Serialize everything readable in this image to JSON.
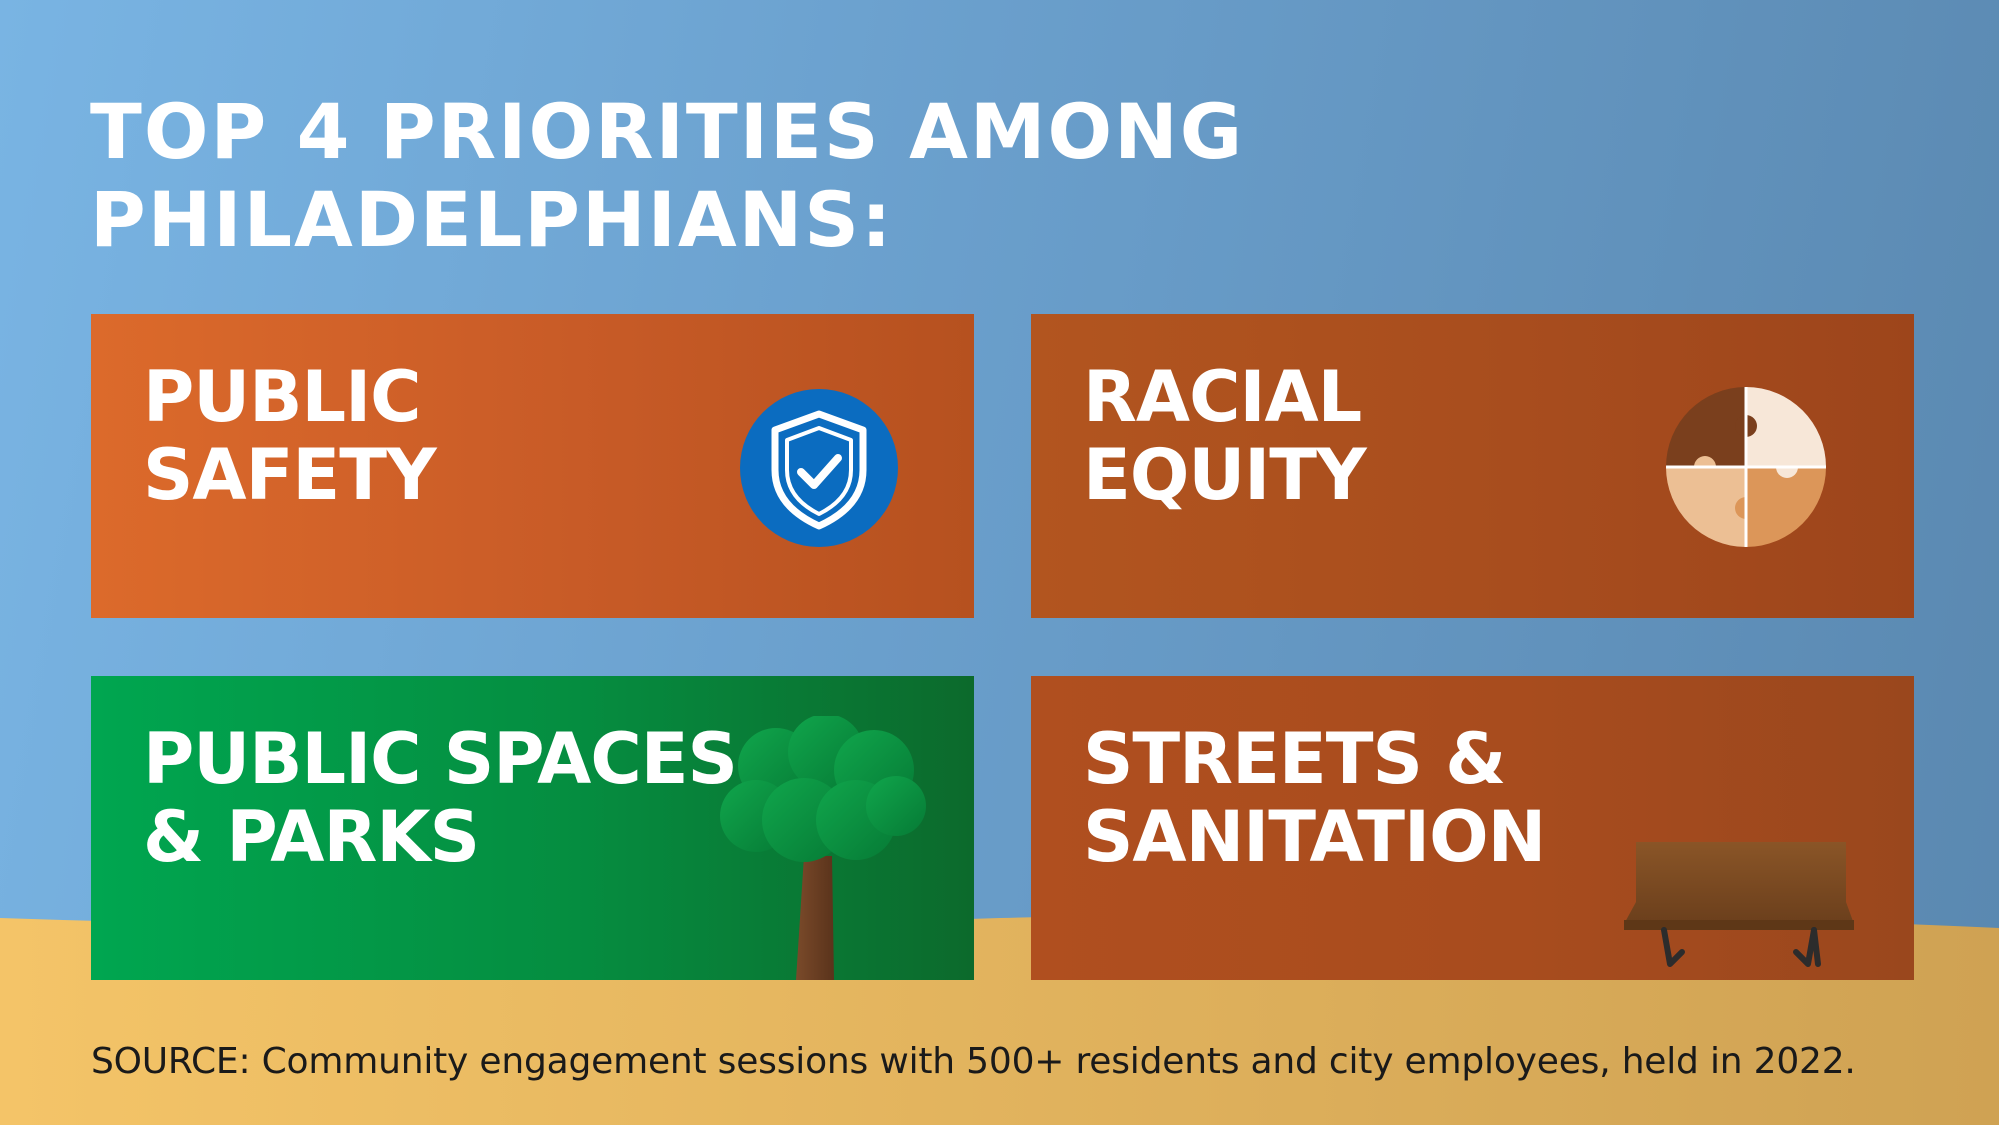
{
  "title": {
    "line1": "TOP 4 PRIORITIES AMONG",
    "line2": "PHILADELPHIANS:"
  },
  "priorities": [
    {
      "line1": "PUBLIC",
      "line2": "SAFETY",
      "icon": "shield-check-icon",
      "color": "#d2642a"
    },
    {
      "line1": "RACIAL",
      "line2": "EQUITY",
      "icon": "puzzle-icon",
      "color": "#a84d1e"
    },
    {
      "line1": "PUBLIC SPACES",
      "line2": "& PARKS",
      "icon": "tree-icon",
      "color": "#00a650"
    },
    {
      "line1": "STREETS &",
      "line2": "SANITATION",
      "icon": "bench-icon",
      "color": "#a84c1e"
    }
  ],
  "source": "SOURCE: Community engagement sessions with 500+ residents and city employees, held in 2022.",
  "colors": {
    "sky": "#6a9fcc",
    "ground": "#e9b960",
    "shield_blue": "#0b6cc0"
  }
}
